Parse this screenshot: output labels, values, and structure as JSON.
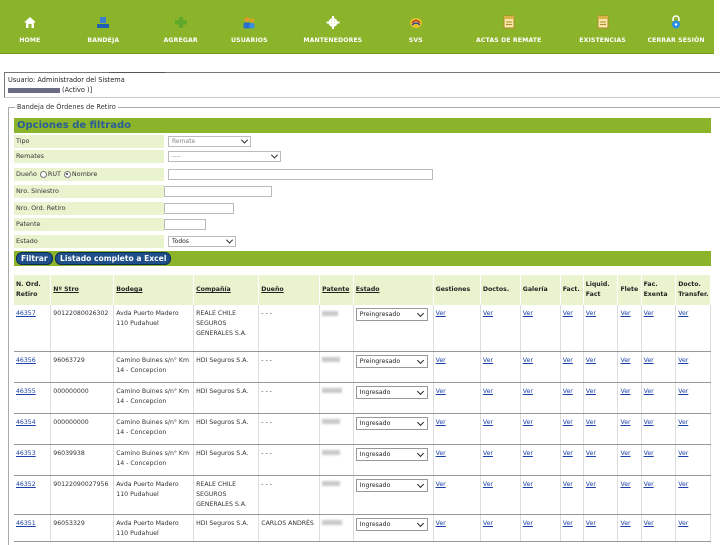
{
  "nav": {
    "items": [
      {
        "label": "HOME",
        "icon": "home-icon"
      },
      {
        "label": "BANDEJA",
        "icon": "inbox-icon"
      },
      {
        "label": "AGREGAR",
        "icon": "add-icon"
      },
      {
        "label": "USUARIOS",
        "icon": "users-icon"
      },
      {
        "label": "MANTENEDORES",
        "icon": "gear-icon"
      },
      {
        "label": "SVS",
        "icon": "svs-icon"
      },
      {
        "label": "ACTAS DE REMATE",
        "icon": "document-icon"
      },
      {
        "label": "EXISTENCIAS",
        "icon": "document-icon"
      },
      {
        "label": "CERRAR SESIÓN",
        "icon": "lock-icon"
      }
    ],
    "accent": "#8cb42b"
  },
  "user": {
    "line1": "Usuario: Administrador del Sistema",
    "status": "(Activo )]"
  },
  "fieldset": {
    "legend": "Bandeja de Órdenes de Retiro"
  },
  "filters": {
    "title": "Opciones de filtrado",
    "tipo_label": "Tipo",
    "tipo_value": "Remate",
    "remates_label": "Remates",
    "remates_value": "----",
    "dueno_label": "Dueño",
    "dueno_opt1": "RUT",
    "dueno_opt2": "Nombre",
    "siniestro_label": "Nro. Siniestro",
    "ord_retiro_label": "Nro. Ord. Retiro",
    "patente_label": "Patente",
    "estado_label": "Estado",
    "estado_value": "Todos",
    "btn_filtrar": "Filtrar",
    "btn_excel": "Listado completo a Excel"
  },
  "table": {
    "headers": {
      "nord": "N. Ord. Retiro",
      "nstro": "Nº Stro",
      "bodega": "Bodega",
      "compania": "Compañía",
      "dueno": "Dueño",
      "patente": "Patente",
      "estado": "Estado",
      "gestiones": "Gestiones",
      "doctos": "Doctos.",
      "galeria": "Galería",
      "fact": "Fact.",
      "liquid": "Liquid. Fact",
      "flete": "Flete",
      "facexenta": "Fac. Exenta",
      "doctotransfer": "Docto. Transfer."
    },
    "link_text": "Ver",
    "rows": [
      {
        "nord": "46357",
        "nstro": "90122080026302",
        "bodega": "Avda Puerto Madero 110 Pudahuel",
        "compania": "REALE CHILE SEGUROS GENERALES S.A.",
        "dueno": "- - -",
        "estado": "Preingresado"
      },
      {
        "nord": "46356",
        "nstro": "96063729",
        "bodega": "Camino Buines s/n° Km 14 - Concepcion",
        "compania": "HDI Seguros S.A.",
        "dueno": "- - -",
        "estado": "Preingresado"
      },
      {
        "nord": "46355",
        "nstro": "000000000",
        "bodega": "Camino Buines s/n° Km 14 - Concepcion",
        "compania": "HDI Seguros S.A.",
        "dueno": "- - -",
        "estado": "Ingresado"
      },
      {
        "nord": "46354",
        "nstro": "000000000",
        "bodega": "Camino Buines s/n° Km 14 - Concepcion",
        "compania": "HDI Seguros S.A.",
        "dueno": "- - -",
        "estado": "Ingresado"
      },
      {
        "nord": "46353",
        "nstro": "96039938",
        "bodega": "Camino Buines s/n° Km 14 - Concepcion",
        "compania": "HDI Seguros S.A.",
        "dueno": "- - -",
        "estado": "Ingresado"
      },
      {
        "nord": "46352",
        "nstro": "90122090027956",
        "bodega": "Avda Puerto Madero 110 Pudahuel",
        "compania": "REALE CHILE SEGUROS GENERALES S.A.",
        "dueno": "- - -",
        "estado": "Ingresado"
      },
      {
        "nord": "46351",
        "nstro": "96053329",
        "bodega": "Avda Puerto Madero 110 Pudahuel",
        "compania": "HDI Seguros S.A.",
        "dueno": "CARLOS ANDRÉS",
        "estado": "Ingresado"
      }
    ]
  }
}
